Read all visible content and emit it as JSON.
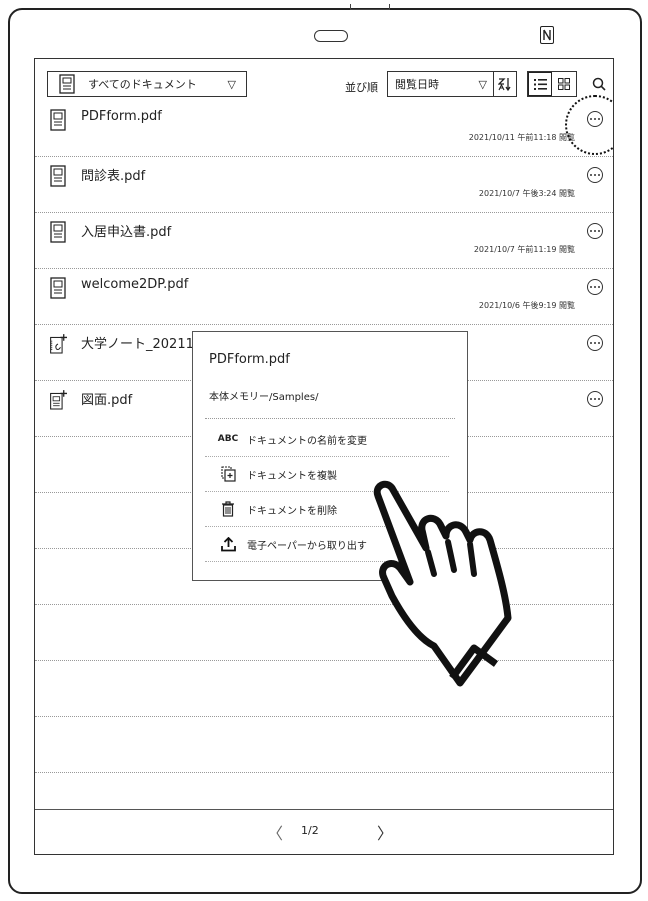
{
  "toolbar": {
    "document_filter": "すべてのドキュメント",
    "sort_label": "並び順",
    "sort_value": "閲覧日時",
    "sort_order_glyph": "ZA"
  },
  "files": [
    {
      "name": "PDFform.pdf",
      "date": "2021/10/11 午前11:18 閲覧"
    },
    {
      "name": "問診表.pdf",
      "date": "2021/10/7 午後3:24 閲覧"
    },
    {
      "name": "入居申込書.pdf",
      "date": "2021/10/7 午前11:19 閲覧"
    },
    {
      "name": "welcome2DP.pdf",
      "date": "2021/10/6 午後9:19 閲覧"
    },
    {
      "name": "大学ノート_20211",
      "date": ""
    },
    {
      "name": "図面.pdf",
      "date": ""
    }
  ],
  "popup": {
    "title": "PDFform.pdf",
    "path": "本体メモリー/Samples/",
    "items": [
      {
        "icon": "rename-icon",
        "glyph": "ABC",
        "label": "ドキュメントの名前を変更"
      },
      {
        "icon": "duplicate-icon",
        "label": "ドキュメントを複製"
      },
      {
        "icon": "trash-icon",
        "label": "ドキュメントを削除"
      },
      {
        "icon": "export-icon",
        "label": "電子ペーパーから取り出す"
      }
    ]
  },
  "pagination": {
    "current": "1/2"
  }
}
